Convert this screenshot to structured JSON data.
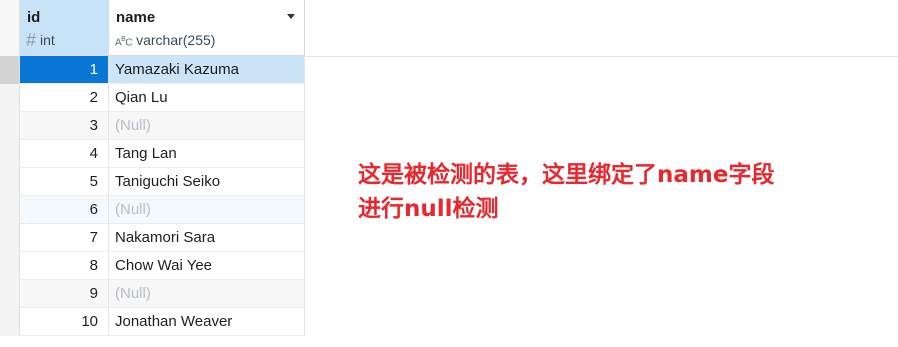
{
  "table": {
    "columns": [
      {
        "name": "id",
        "type": "int",
        "type_icon": "hash-icon"
      },
      {
        "name": "name",
        "type": "varchar(255)",
        "type_icon": "abc-icon"
      }
    ],
    "rows": [
      {
        "id": "1",
        "name": "Yamazaki Kazuma"
      },
      {
        "id": "2",
        "name": "Qian Lu"
      },
      {
        "id": "3",
        "name": "(Null)"
      },
      {
        "id": "4",
        "name": "Tang Lan"
      },
      {
        "id": "5",
        "name": "Taniguchi Seiko"
      },
      {
        "id": "6",
        "name": "(Null)"
      },
      {
        "id": "7",
        "name": "Nakamori Sara"
      },
      {
        "id": "8",
        "name": "Chow Wai Yee"
      },
      {
        "id": "9",
        "name": "(Null)"
      },
      {
        "id": "10",
        "name": "Jonathan Weaver"
      }
    ]
  },
  "annotation": {
    "line1": "这是被检测的表，这里绑定了name字段",
    "line2": "进行null检测",
    "color": "#e8282f"
  },
  "colors": {
    "selected_cell": "#0a77d6",
    "selected_row": "#cce4f7",
    "header_selected": "#c8e3f7",
    "null_text": "#b7bdc5"
  }
}
